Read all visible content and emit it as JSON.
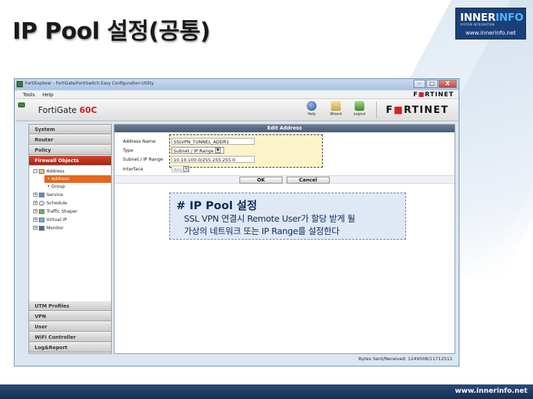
{
  "slide": {
    "title": "IP Pool 설정(공통)",
    "footer_url": "www.innerinfo.net"
  },
  "logo": {
    "name_a": "INNER",
    "name_b": "INFO",
    "subtitle": "SYSTEM INTEGRATION",
    "url": "www.innerinfo.net"
  },
  "window": {
    "title": "FortiExplorer - FortiGate/FortiSwitch Easy Configuration Utility",
    "controls": {
      "minimize": "–",
      "maximize": "□",
      "close": "X"
    },
    "menu": [
      "Tools",
      "Help"
    ],
    "brand_a": "F",
    "brand_b": "RTINET",
    "device_prefix": "FortiGate",
    "device_model": "60C",
    "toolbar": {
      "help": "Help",
      "wizard": "Wizard",
      "logout": "Logout"
    },
    "status": "Bytes Sent/Received: 1249508/11712511"
  },
  "nav": {
    "top_sections": [
      "System",
      "Router",
      "Policy"
    ],
    "active_section": "Firewall Objects",
    "tree": {
      "address": "Address",
      "address_child": "Address",
      "group": "Group",
      "service": "Service",
      "schedule": "Schedule",
      "traffic_shaper": "Traffic Shaper",
      "virtual_ip": "Virtual IP",
      "monitor": "Monitor"
    },
    "bottom_sections": [
      "UTM Profiles",
      "VPN",
      "User",
      "WiFi Controller",
      "Log&Report"
    ]
  },
  "form": {
    "header": "Edit Address",
    "labels": {
      "name": "Address Name",
      "type": "Type",
      "subnet": "Subnet / IP Range",
      "interface": "Interface"
    },
    "values": {
      "name": "SSLVPN_TUNNEL_ADDR1",
      "type": "Subnet / IP Range",
      "subnet": "10.10.100.0/255.255.255.0",
      "interface": "Any"
    },
    "ok": "OK",
    "cancel": "Cancel"
  },
  "callout": {
    "title": "# IP Pool 설정",
    "line1": "SSL VPN 연결시  Remote User가 할당 받게 될",
    "line2": "가상의 네트워크 또는 IP Range를 설정한다"
  }
}
